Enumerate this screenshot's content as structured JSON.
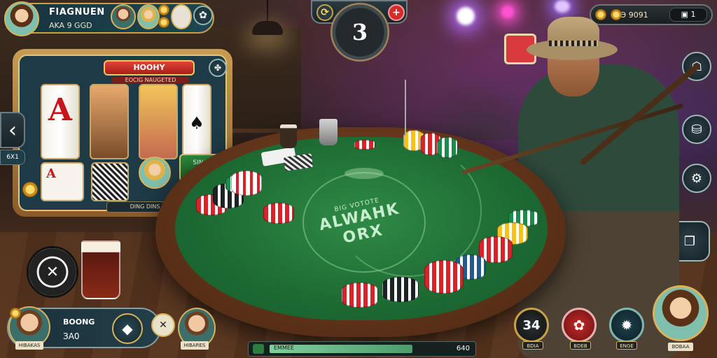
{
  "top_player": {
    "name": "FIAGNUEN",
    "subtitle": "AKA 9 GGD"
  },
  "timer": {
    "value": "3"
  },
  "balance": {
    "amount": "ВӨ 9091",
    "tag": "1"
  },
  "slot": {
    "title": "HOOHY",
    "subtitle": "EOCIG NAUGETED",
    "green_panel": "SINA",
    "banner": "DING DINS",
    "reel1": "A",
    "card_small": "A"
  },
  "left_tag": "6X1",
  "felt": {
    "line1": "ALWAHK",
    "line2": "ORX",
    "small": "BIG VOTOTE"
  },
  "bottom_player": {
    "name": "BOONG",
    "amount": "ЗА0",
    "label_left": "HIBAKAS",
    "label_right": "HIBARES"
  },
  "progress": {
    "label": "EMMEE",
    "right_text": "640",
    "fill": 0.85
  },
  "actions": [
    {
      "text": "34",
      "label": "BDIA"
    },
    {
      "text": "",
      "label": "BDEB"
    },
    {
      "text": "",
      "label": "ENGE"
    }
  ],
  "right_avatar_label": "BOBAA",
  "colors": {
    "felt": "#1d6a33",
    "gold": "#d9b35c",
    "panel": "#1e4652"
  }
}
